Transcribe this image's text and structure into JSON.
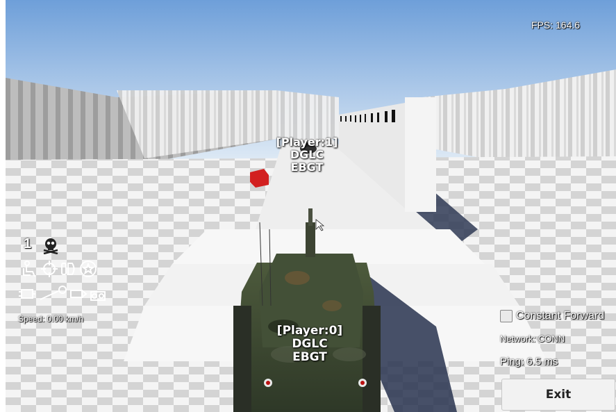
{
  "hud": {
    "fps": "FPS: 164.6",
    "speed": "Speed: 0.00 km/h",
    "network": "Network: CONN",
    "ping": "Ping: 6.5 ms",
    "constant_forward_label": "Constant Forward",
    "constant_forward_checked": false,
    "exit_label": "Exit",
    "count_indicator": "1"
  },
  "players": [
    {
      "name": "[Player:1]",
      "line2": "DGLC",
      "line3": "EBGT"
    },
    {
      "name": "[Player:0]",
      "line2": "DGLC",
      "line3": "EBGT"
    }
  ],
  "status_icons": [
    {
      "name": "skull-crossbones-icon"
    },
    {
      "name": "crew-seat-icon"
    },
    {
      "name": "crosshair-icon"
    },
    {
      "name": "loader-icon"
    },
    {
      "name": "star-icon"
    },
    {
      "name": "engine-icon"
    },
    {
      "name": "wrench-icon"
    },
    {
      "name": "ammo-icon"
    },
    {
      "name": "track-icon"
    }
  ],
  "colors": {
    "sky_top": "#6e9fd9",
    "sky_horizon": "#dde9f5",
    "hud_text": "#ffffff",
    "red_crate": "#d22020"
  }
}
